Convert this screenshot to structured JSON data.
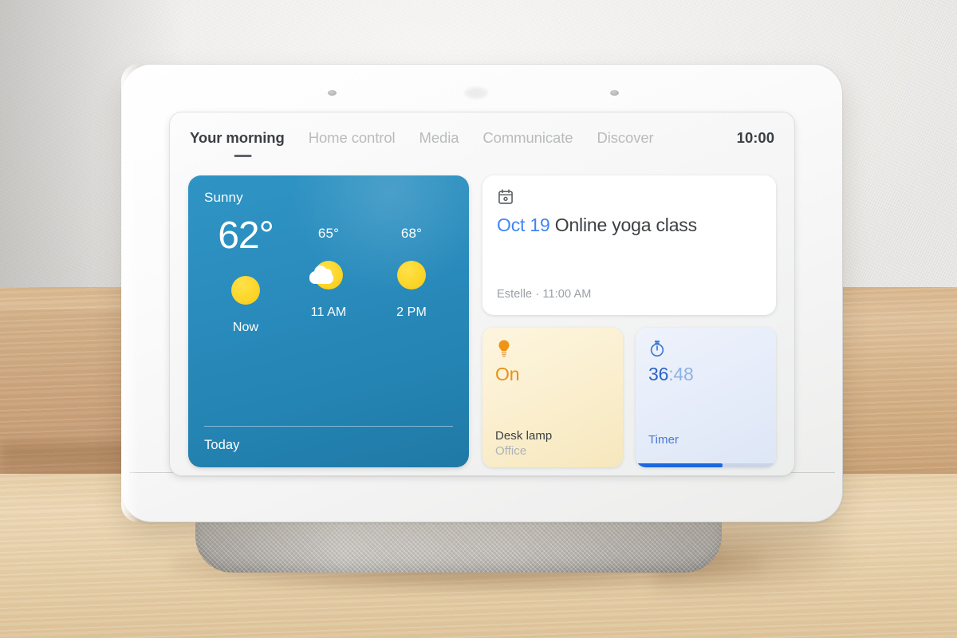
{
  "device": {
    "name": "Google Nest Hub smart display",
    "sensors": [
      "sensor-left",
      "sensor-center",
      "sensor-right"
    ]
  },
  "screen": {
    "tabs": [
      {
        "label": "Your morning",
        "active": true
      },
      {
        "label": "Home control",
        "active": false
      },
      {
        "label": "Media",
        "active": false
      },
      {
        "label": "Communicate",
        "active": false
      },
      {
        "label": "Discover",
        "active": false
      }
    ],
    "clock": "10:00"
  },
  "weather": {
    "condition": "Sunny",
    "current_temp": "62°",
    "footer": "Today",
    "forecast": [
      {
        "temp": "",
        "icon": "sun-icon",
        "label": "Now"
      },
      {
        "temp": "65°",
        "icon": "sun-cloud-icon",
        "label": "11 AM"
      },
      {
        "temp": "68°",
        "icon": "sun-icon",
        "label": "2 PM"
      }
    ],
    "accent": "#2a8cbd",
    "sun_color": "#fcd629"
  },
  "calendar": {
    "icon": "calendar-icon",
    "date": "Oct 19",
    "title": "Online yoga class",
    "subtitle": "Estelle · 11:00 AM",
    "date_color": "#4285f4"
  },
  "lamp_tile": {
    "icon": "lightbulb-icon",
    "state": "On",
    "name": "Desk lamp",
    "room": "Office",
    "accent": "#e8901a"
  },
  "timer_tile": {
    "icon": "stopwatch-icon",
    "minutes": "36",
    "separator": ":",
    "seconds": "48",
    "label": "Timer",
    "progress_percent": 62,
    "accent": "#1b67e0"
  }
}
